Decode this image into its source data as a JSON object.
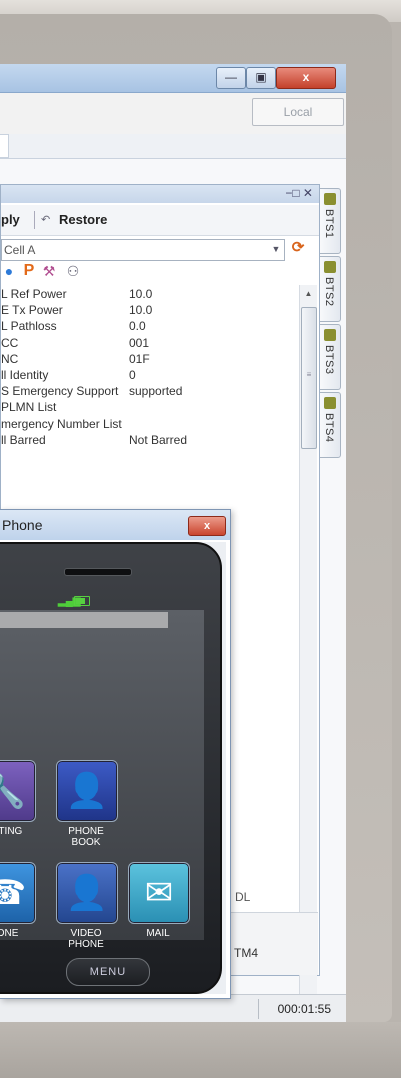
{
  "main_window": {
    "local_label": "Local",
    "controls": {
      "minimize": "—",
      "maximize": "▣",
      "close": "x"
    }
  },
  "dock_tabs": [
    {
      "label": "BTS1",
      "icon": "antenna-icon"
    },
    {
      "label": "BTS2",
      "icon": "antenna-icon"
    },
    {
      "label": "BTS3",
      "icon": "antenna-icon"
    },
    {
      "label": "BTS4",
      "icon": "antenna-icon"
    }
  ],
  "cell_panel": {
    "pin_close": "−□ ✕",
    "apply_label": "ply",
    "restore_label": "Restore",
    "cell_selector_value": "Cell A",
    "properties": [
      {
        "key": "L Ref Power",
        "value": "10.0"
      },
      {
        "key": "E Tx Power",
        "value": "10.0"
      },
      {
        "key": "L Pathloss",
        "value": "0.0"
      },
      {
        "key": "CC",
        "value": "001"
      },
      {
        "key": "NC",
        "value": "01F"
      },
      {
        "key": "ll Identity",
        "value": "0"
      },
      {
        "key": "S Emergency Support",
        "value": "supported"
      },
      {
        "key": "PLMN List",
        "value": ""
      },
      {
        "key": "mergency Number List",
        "value": ""
      },
      {
        "key": "ll Barred",
        "value": "Not Barred"
      }
    ],
    "dl_label": "DL",
    "tm_label": "TM4"
  },
  "status_bar": {
    "elapsed_time": "000:01:55"
  },
  "phone_window": {
    "title": "Phone",
    "close_label": "x",
    "apps": [
      {
        "label": "ETTING",
        "glyph": "🔧",
        "color": "#6a4fa3"
      },
      {
        "label": "PHONE\nBOOK",
        "glyph": "👤",
        "color": "#2b46a6"
      },
      {
        "label": "HONE",
        "glyph": "☎",
        "color": "#2a7fc9"
      },
      {
        "label": "VIDEO\nPHONE",
        "glyph": "👤",
        "color": "#2f5aa8"
      },
      {
        "label": "MAIL",
        "glyph": "✉",
        "color": "#3aa2c4"
      }
    ],
    "menu_label": "MENU"
  }
}
